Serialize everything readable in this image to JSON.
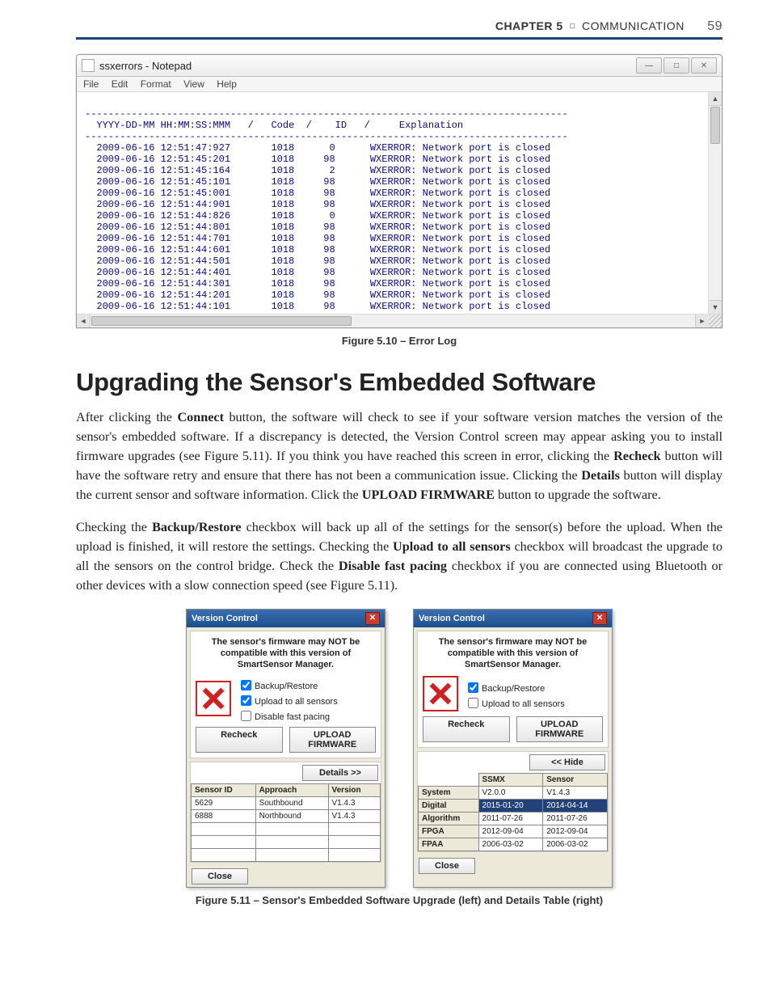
{
  "header": {
    "chapter_label": "CHAPTER 5",
    "square": "□",
    "section_label": "COMMUNICATION",
    "page_number": "59"
  },
  "notepad": {
    "title": "ssxerrors - Notepad",
    "menu": {
      "file": "File",
      "edit": "Edit",
      "format": "Format",
      "view": "View",
      "help": "Help"
    },
    "header_line": "  YYYY-DD-MM HH:MM:SS:MMM   /   Code  /    ID   /     Explanation",
    "dash_line": "-----------------------------------------------------------------------------------",
    "rows": [
      {
        "ts": "2009-06-16 12:51:47:927",
        "code": "1018",
        "id": "0",
        "msg": "WXERROR: Network port is closed"
      },
      {
        "ts": "2009-06-16 12:51:45:201",
        "code": "1018",
        "id": "98",
        "msg": "WXERROR: Network port is closed"
      },
      {
        "ts": "2009-06-16 12:51:45:164",
        "code": "1018",
        "id": "2",
        "msg": "WXERROR: Network port is closed"
      },
      {
        "ts": "2009-06-16 12:51:45:101",
        "code": "1018",
        "id": "98",
        "msg": "WXERROR: Network port is closed"
      },
      {
        "ts": "2009-06-16 12:51:45:001",
        "code": "1018",
        "id": "98",
        "msg": "WXERROR: Network port is closed"
      },
      {
        "ts": "2009-06-16 12:51:44:901",
        "code": "1018",
        "id": "98",
        "msg": "WXERROR: Network port is closed"
      },
      {
        "ts": "2009-06-16 12:51:44:826",
        "code": "1018",
        "id": "0",
        "msg": "WXERROR: Network port is closed"
      },
      {
        "ts": "2009-06-16 12:51:44:801",
        "code": "1018",
        "id": "98",
        "msg": "WXERROR: Network port is closed"
      },
      {
        "ts": "2009-06-16 12:51:44:701",
        "code": "1018",
        "id": "98",
        "msg": "WXERROR: Network port is closed"
      },
      {
        "ts": "2009-06-16 12:51:44:601",
        "code": "1018",
        "id": "98",
        "msg": "WXERROR: Network port is closed"
      },
      {
        "ts": "2009-06-16 12:51:44:501",
        "code": "1018",
        "id": "98",
        "msg": "WXERROR: Network port is closed"
      },
      {
        "ts": "2009-06-16 12:51:44:401",
        "code": "1018",
        "id": "98",
        "msg": "WXERROR: Network port is closed"
      },
      {
        "ts": "2009-06-16 12:51:44:301",
        "code": "1018",
        "id": "98",
        "msg": "WXERROR: Network port is closed"
      },
      {
        "ts": "2009-06-16 12:51:44:201",
        "code": "1018",
        "id": "98",
        "msg": "WXERROR: Network port is closed"
      },
      {
        "ts": "2009-06-16 12:51:44:101",
        "code": "1018",
        "id": "98",
        "msg": "WXERROR: Network port is closed"
      }
    ]
  },
  "captions": {
    "fig510": "Figure 5.10 – Error Log",
    "fig511": "Figure 5.11 – Sensor's Embedded Software Upgrade (left) and Details Table (right)"
  },
  "heading": "Upgrading the Sensor's Embedded Software",
  "para1": {
    "t0": "After clicking the ",
    "b0": "Connect",
    "t1": " button, the software will check to see if your software version matches the version of the sensor's embedded software. If a discrepancy is detected, the Version Control screen may appear asking you to install firmware upgrades (see Figure 5.11). If you think you have reached this screen in error, clicking the ",
    "b1": "Recheck",
    "t2": " button will have the software retry and ensure that there has not been a communication issue. Clicking the ",
    "b2": "Details",
    "t3": " button will display the current sensor and software information. Click the ",
    "b3": "UPLOAD FIRMWARE",
    "t4": " button to upgrade the software."
  },
  "para2": {
    "t0": "Checking the ",
    "b0": "Backup/Restore",
    "t1": " checkbox will back up all of the settings for the sensor(s) before the upload. When the upload is finished, it will restore the settings. Checking the ",
    "b1": "Upload to all sensors",
    "t2": " checkbox will broadcast the upgrade to all the sensors on the control bridge. Check the ",
    "b2": "Disable fast pacing",
    "t3": " checkbox if you are connected using Bluetooth or other devices with a slow connection speed (see Figure 5.11)."
  },
  "dialog": {
    "title": "Version Control",
    "warning": "The sensor's firmware may NOT be compatible with this version of SmartSensor Manager.",
    "chk_backup": "Backup/Restore",
    "chk_upload": "Upload to all sensors",
    "chk_pacing": "Disable fast pacing",
    "btn_recheck": "Recheck",
    "btn_upload": "UPLOAD FIRMWARE",
    "btn_details": "Details >>",
    "btn_hide": "<< Hide",
    "btn_close": "Close",
    "left_table": {
      "headers": {
        "sensor_id": "Sensor ID",
        "approach": "Approach",
        "version": "Version"
      },
      "rows": [
        {
          "id": "5629",
          "approach": "Southbound",
          "version": "V1.4.3"
        },
        {
          "id": "6888",
          "approach": "Northbound",
          "version": "V1.4.3"
        }
      ]
    },
    "right_table": {
      "headers": {
        "ssmx": "SSMX",
        "sensor": "Sensor"
      },
      "rows": [
        {
          "label": "System",
          "ssmx": "V2.0.0",
          "sensor": "V1.4.3"
        },
        {
          "label": "Digital",
          "ssmx": "2015-01-20",
          "sensor": "2014-04-14"
        },
        {
          "label": "Algorithm",
          "ssmx": "2011-07-26",
          "sensor": "2011-07-26"
        },
        {
          "label": "FPGA",
          "ssmx": "2012-09-04",
          "sensor": "2012-09-04"
        },
        {
          "label": "FPAA",
          "ssmx": "2006-03-02",
          "sensor": "2006-03-02"
        }
      ]
    }
  }
}
